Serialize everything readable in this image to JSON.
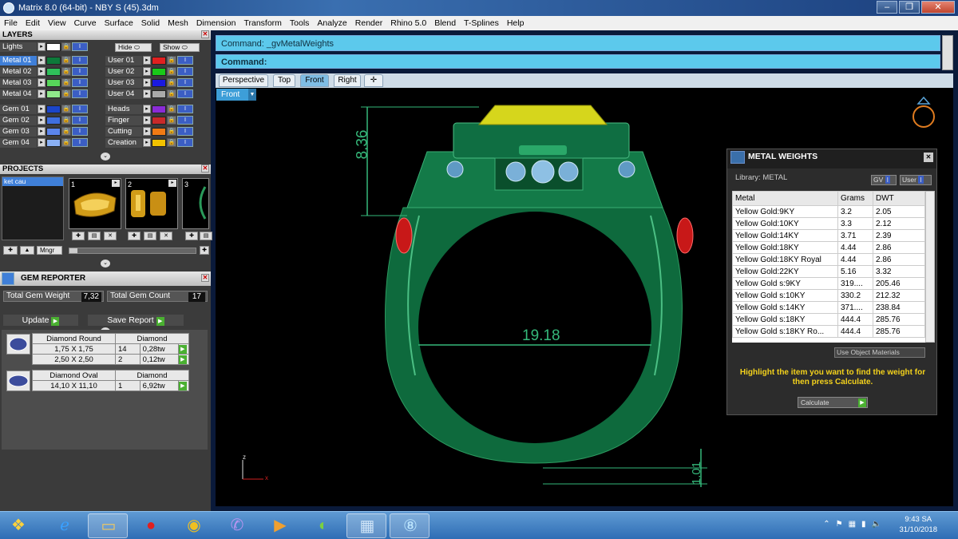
{
  "window": {
    "title": "Matrix 8.0 (64-bit) - NBY S (45).3dm"
  },
  "menu": [
    "File",
    "Edit",
    "View",
    "Curve",
    "Surface",
    "Solid",
    "Mesh",
    "Dimension",
    "Transform",
    "Tools",
    "Analyze",
    "Render",
    "Rhino 5.0",
    "Blend",
    "T-Splines",
    "Help"
  ],
  "layers": {
    "title": "LAYERS",
    "lights": "Lights",
    "hide": "Hide",
    "show": "Show",
    "left": [
      {
        "name": "Metal 01",
        "color": "#0d7a3a"
      },
      {
        "name": "Metal 02",
        "color": "#2fbf5a"
      },
      {
        "name": "Metal 03",
        "color": "#57d65a"
      },
      {
        "name": "Metal 04",
        "color": "#8fe88a"
      },
      {
        "name": "Gem 01",
        "color": "#1b45c9"
      },
      {
        "name": "Gem 02",
        "color": "#3f6fe0"
      },
      {
        "name": "Gem 03",
        "color": "#5b85ec"
      },
      {
        "name": "Gem 04",
        "color": "#8ab0f4"
      }
    ],
    "right": [
      {
        "name": "User 01",
        "color": "#e02020"
      },
      {
        "name": "User 02",
        "color": "#19c919"
      },
      {
        "name": "User 03",
        "color": "#1a1ae0"
      },
      {
        "name": "User 04",
        "color": "#aaaaaa"
      },
      {
        "name": "Heads",
        "color": "#8a2bd6"
      },
      {
        "name": "Finger",
        "color": "#c82a2a"
      },
      {
        "name": "Cutting",
        "color": "#f07a14"
      },
      {
        "name": "Creation",
        "color": "#f2c200"
      }
    ]
  },
  "projects": {
    "title": "PROJECTS",
    "list_item": "ket cau",
    "thumbs": [
      "1",
      "2",
      "3"
    ],
    "mngr": "Mngr"
  },
  "gem_reporter": {
    "title": "GEM REPORTER",
    "total_weight_label": "Total Gem Weight",
    "total_weight": "7,32",
    "total_count_label": "Total Gem Count",
    "total_count": "17",
    "update": "Update",
    "save_report": "Save Report",
    "groups": [
      {
        "name": "Diamond Round",
        "material": "Diamond",
        "rows": [
          [
            "1,75 X 1,75",
            "14",
            "0,28tw"
          ],
          [
            "2,50 X 2,50",
            "2",
            "0,12tw"
          ]
        ]
      },
      {
        "name": "Diamond Oval",
        "material": "Diamond",
        "rows": [
          [
            "14,10 X 11,10",
            "1",
            "6,92tw"
          ]
        ]
      }
    ]
  },
  "command": {
    "line1": "Command: _gvMetalWeights",
    "line2": "Command:"
  },
  "viewport_tabs": [
    "Perspective",
    "Top",
    "Front",
    "Right"
  ],
  "viewport_label": "Front",
  "dimensions": {
    "top": "8.36",
    "inner": "19.18",
    "bottom": "1.01"
  },
  "axis": {
    "z": "z",
    "x": "x"
  },
  "metal_weights": {
    "title": "METAL WEIGHTS",
    "library": "Library: METAL",
    "gv": "GV",
    "user": "User",
    "headers": [
      "Metal",
      "Grams",
      "DWT"
    ],
    "rows": [
      [
        "Yellow Gold:9KY",
        "3.2",
        "2.05"
      ],
      [
        "Yellow Gold:10KY",
        "3.3",
        "2.12"
      ],
      [
        "Yellow Gold:14KY",
        "3.71",
        "2.39"
      ],
      [
        "Yellow Gold:18KY",
        "4.44",
        "2.86"
      ],
      [
        "Yellow Gold:18KY Royal",
        "4.44",
        "2.86"
      ],
      [
        "Yellow Gold:22KY",
        "5.16",
        "3.32"
      ],
      [
        "Yellow Gold s:9KY",
        "319....",
        "205.46"
      ],
      [
        "Yellow Gold s:10KY",
        "330.2",
        "212.32"
      ],
      [
        "Yellow Gold s:14KY",
        "371....",
        "238.84"
      ],
      [
        "Yellow Gold s:18KY",
        "444.4",
        "285.76"
      ],
      [
        "Yellow Gold s:18KY Ro...",
        "444.4",
        "285.76"
      ]
    ],
    "use_object": "Use Object Materials",
    "message": "Highlight the item you want to find the weight for then press Calculate.",
    "calculate": "Calculate"
  },
  "taskbar": {
    "time": "9:43 SA",
    "date": "31/10/2018"
  }
}
